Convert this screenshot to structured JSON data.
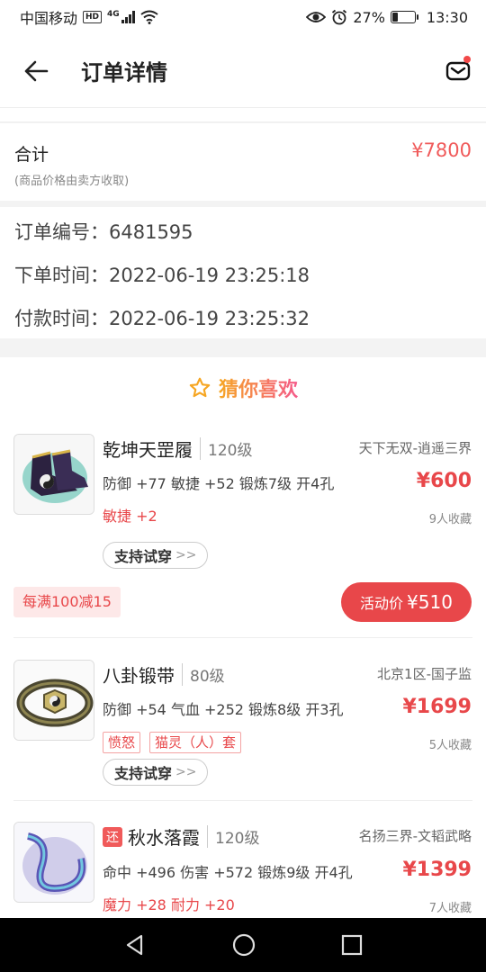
{
  "status_bar": {
    "carrier": "中国移动",
    "hd": "HD",
    "network": "4G",
    "battery_pct": "27%",
    "battery_level": 0.27,
    "time": "13:30"
  },
  "header": {
    "title": "订单详情"
  },
  "total": {
    "label": "合计",
    "note": "(商品价格由卖方收取)",
    "value": "¥7800"
  },
  "order_info": [
    {
      "label": "订单编号：",
      "value": "6481595"
    },
    {
      "label": "下单时间：",
      "value": "2022-06-19 23:25:18"
    },
    {
      "label": "付款时间：",
      "value": "2022-06-19 23:25:32"
    }
  ],
  "recommend": {
    "title": "猜你喜欢",
    "items": [
      {
        "name": "乾坤天罡履",
        "level": "120级",
        "server": "天下无双-逍遥三界",
        "attrs": "防御 +77 敏捷 +52 锻炼7级 开4孔",
        "extra": "敏捷 +2",
        "price": "¥600",
        "favs": "9人收藏",
        "try_label": "支持试穿",
        "promo": "每满100减15",
        "activity_label": "活动价",
        "activity_price": "¥510"
      },
      {
        "name": "八卦锻带",
        "level": "80级",
        "server": "北京1区-国子监",
        "attrs": "防御 +54 气血 +252 锻炼8级 开3孔",
        "tags": [
          "愤怒",
          "猫灵（人）套"
        ],
        "price": "¥1699",
        "favs": "5人收藏",
        "try_label": "支持试穿"
      },
      {
        "badge": "还",
        "name": "秋水落霞",
        "level": "120级",
        "server": "名扬三界-文韬武略",
        "attrs": "命中 +496 伤害 +572 锻炼9级 开4孔",
        "extra": "魔力 +28 耐力 +20",
        "price": "¥1399",
        "favs": "7人收藏"
      }
    ]
  }
}
